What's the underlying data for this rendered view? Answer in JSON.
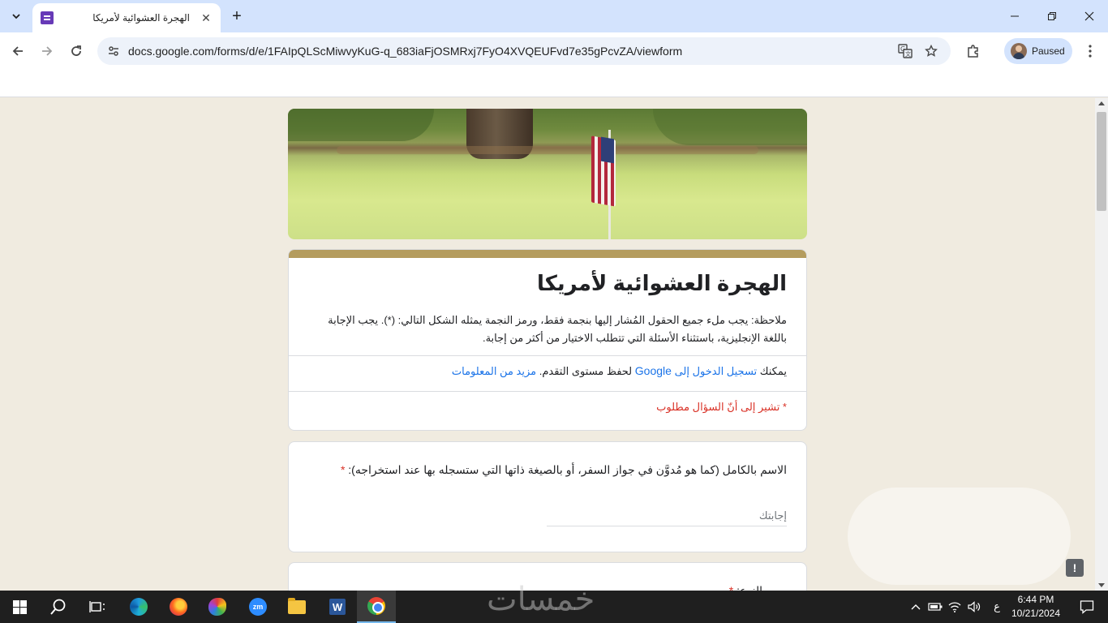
{
  "browser": {
    "tab_title": "الهجرة العشوائية لأمريكا",
    "tab_close": "✕",
    "new_tab": "+",
    "url": "docs.google.com/forms/d/e/1FAIpQLScMiwvyKuG-q_683iaFjOSMRxj7FyO4XVQEUFvd7e35gPcvZA/viewform",
    "profile_label": "Paused",
    "icons": {
      "back": "arrow-left-icon",
      "forward": "arrow-right-icon",
      "reload": "reload-icon",
      "site_info": "tune-icon",
      "translate": "translate-icon",
      "bookmark": "star-icon",
      "extensions": "puzzle-icon",
      "menu": "kebab-menu-icon"
    }
  },
  "form": {
    "title": "الهجرة العشوائية لأمريكا",
    "description": "ملاحظة: يجب ملء جميع الحقول المُشار إليها بنجمة فقط، ورمز النجمة يمثله الشكل التالي: (*). يجب الإجابة باللغة الإنجليزية، باستثناء الأسئلة التي تتطلب الاختيار من أكثر من إجابة.",
    "signin_prefix": "يمكنك",
    "signin_link": "تسجيل الدخول إلى",
    "signin_google": "Google",
    "signin_suffix": "لحفظ مستوى التقدم.",
    "more_info": "مزيد من المعلومات",
    "required_note": "* تشير إلى أنّ السؤال مطلوب",
    "accent_color": "#b49c5e",
    "questions": [
      {
        "label": "الاسم بالكامل (كما هو مُدوَّن في جواز السفر، أو بالصيغة ذاتها التي ستسجله بها عند استخراجه):",
        "required_mark": "*",
        "placeholder": "إجابتك"
      },
      {
        "label": "النوع:",
        "required_mark": "*"
      }
    ]
  },
  "taskbar": {
    "watermark": "خمسات",
    "language": "ع",
    "time": "6:44 PM",
    "date": "10/21/2024",
    "apps": [
      "start-icon",
      "search-icon",
      "task-view-icon",
      "edge-icon",
      "firefox-icon",
      "paint-icon",
      "zoom-icon",
      "file-explorer-icon",
      "word-icon",
      "chrome-icon"
    ]
  }
}
